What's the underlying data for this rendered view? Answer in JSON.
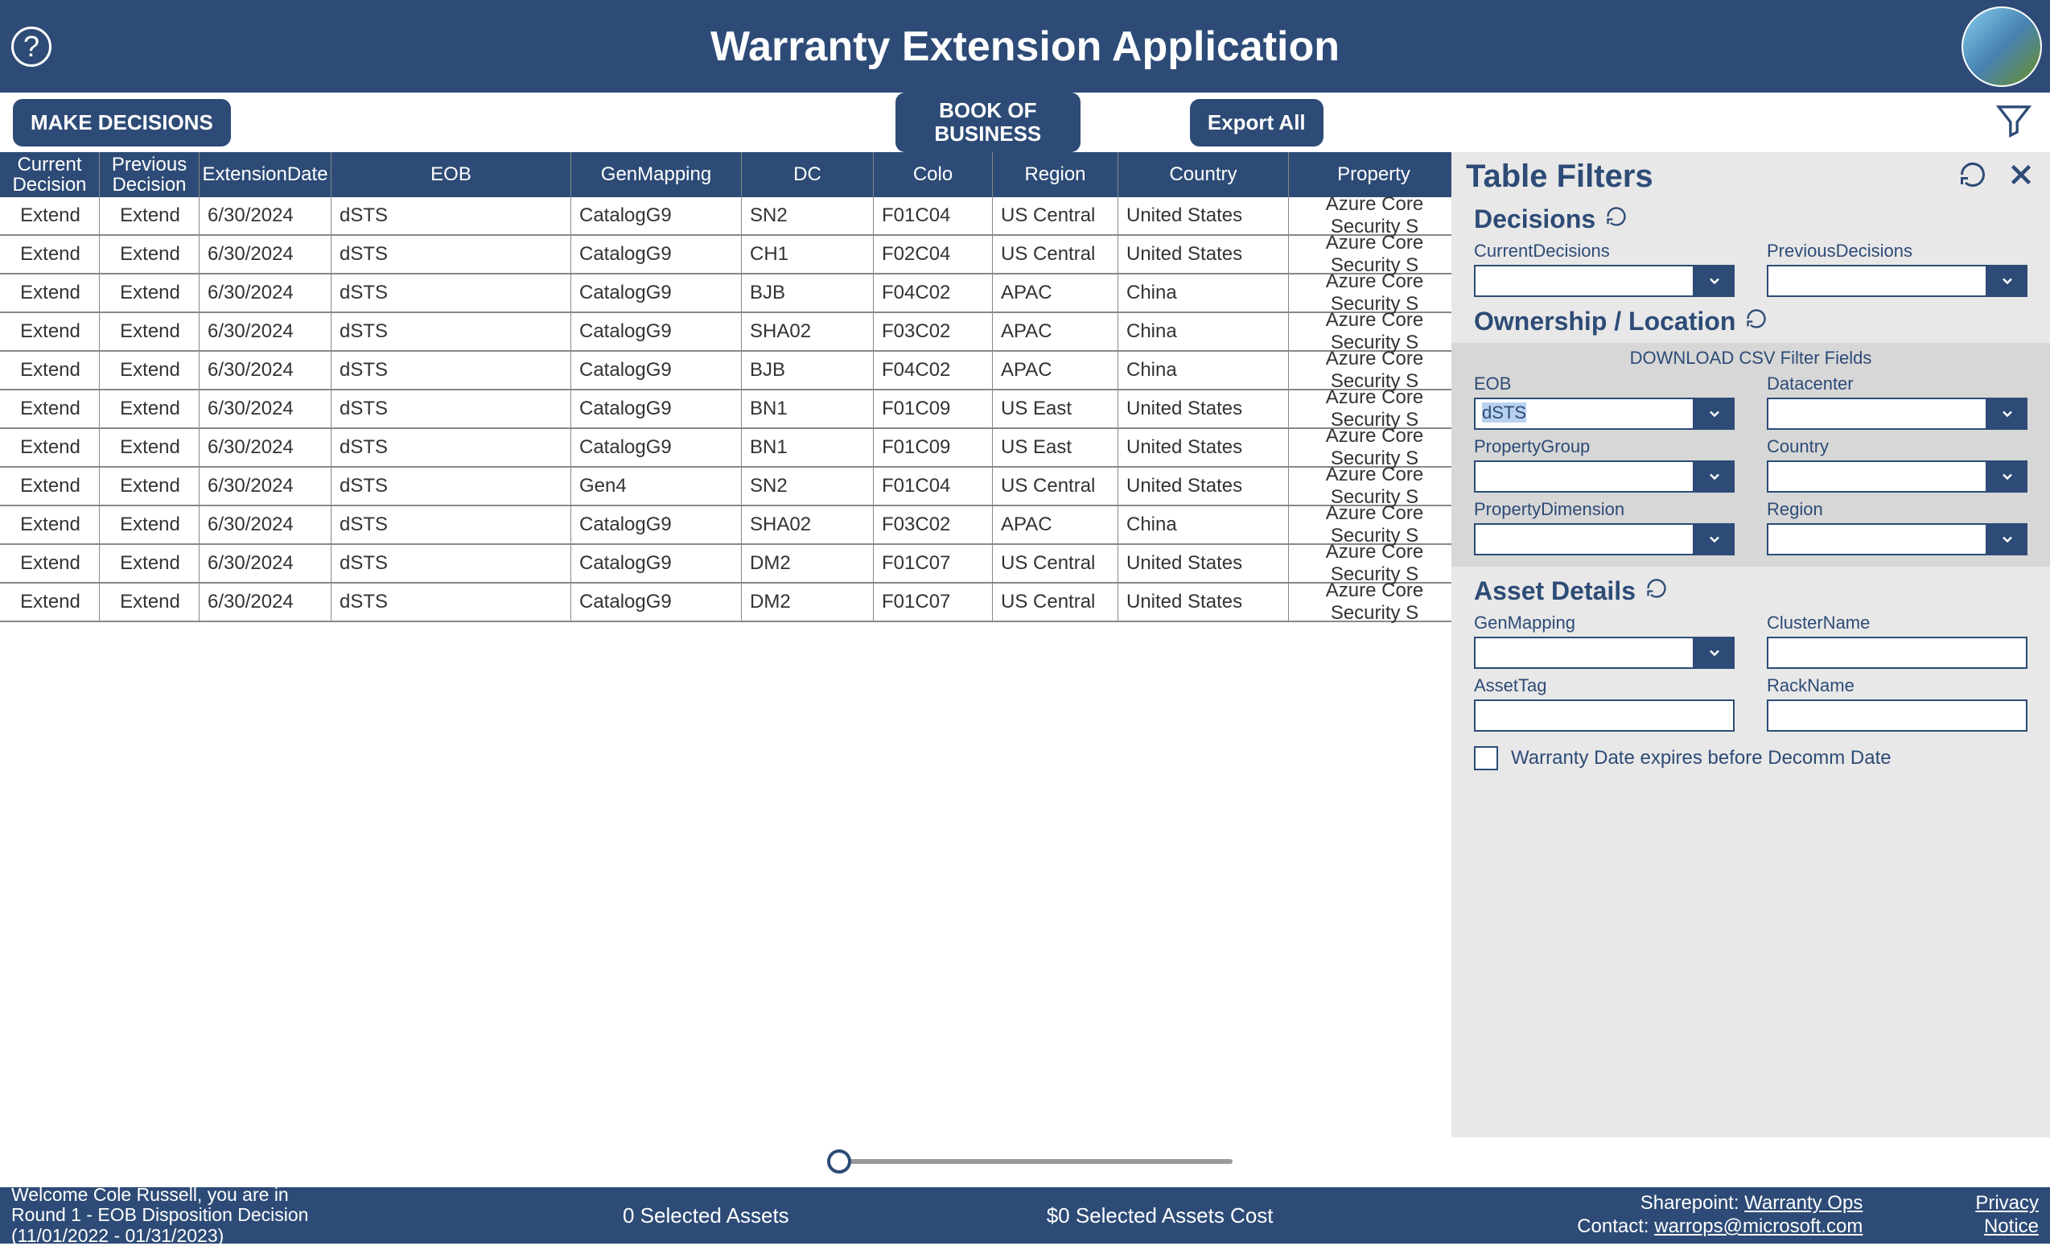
{
  "header": {
    "title": "Warranty Extension Application"
  },
  "toolbar": {
    "make_decisions": "MAKE DECISIONS",
    "book_of_business": "BOOK OF BUSINESS",
    "export_all": "Export All"
  },
  "columns": [
    "Current Decision",
    "Previous Decision",
    "ExtensionDate",
    "EOB",
    "GenMapping",
    "DC",
    "Colo",
    "Region",
    "Country",
    "PropertyGroup"
  ],
  "col_labels": {
    "c0a": "Current",
    "c0b": "Decision",
    "c1a": "Previous",
    "c1b": "Decision",
    "c2": "ExtensionDate",
    "c3": "EOB",
    "c4": "GenMapping",
    "c5": "DC",
    "c6": "Colo",
    "c7": "Region",
    "c8": "Country",
    "c9": "Property"
  },
  "rows": [
    {
      "cur": "Extend",
      "prev": "Extend",
      "ext": "6/30/2024",
      "eob": "dSTS",
      "gen": "CatalogG9",
      "dc": "SN2",
      "colo": "F01C04",
      "region": "US Central",
      "country": "United States",
      "prop": "Azure Core Security S"
    },
    {
      "cur": "Extend",
      "prev": "Extend",
      "ext": "6/30/2024",
      "eob": "dSTS",
      "gen": "CatalogG9",
      "dc": "CH1",
      "colo": "F02C04",
      "region": "US Central",
      "country": "United States",
      "prop": "Azure Core Security S"
    },
    {
      "cur": "Extend",
      "prev": "Extend",
      "ext": "6/30/2024",
      "eob": "dSTS",
      "gen": "CatalogG9",
      "dc": "BJB",
      "colo": "F04C02",
      "region": "APAC",
      "country": "China",
      "prop": "Azure Core Security S"
    },
    {
      "cur": "Extend",
      "prev": "Extend",
      "ext": "6/30/2024",
      "eob": "dSTS",
      "gen": "CatalogG9",
      "dc": "SHA02",
      "colo": "F03C02",
      "region": "APAC",
      "country": "China",
      "prop": "Azure Core Security S"
    },
    {
      "cur": "Extend",
      "prev": "Extend",
      "ext": "6/30/2024",
      "eob": "dSTS",
      "gen": "CatalogG9",
      "dc": "BJB",
      "colo": "F04C02",
      "region": "APAC",
      "country": "China",
      "prop": "Azure Core Security S"
    },
    {
      "cur": "Extend",
      "prev": "Extend",
      "ext": "6/30/2024",
      "eob": "dSTS",
      "gen": "CatalogG9",
      "dc": "BN1",
      "colo": "F01C09",
      "region": "US East",
      "country": "United States",
      "prop": "Azure Core Security S"
    },
    {
      "cur": "Extend",
      "prev": "Extend",
      "ext": "6/30/2024",
      "eob": "dSTS",
      "gen": "CatalogG9",
      "dc": "BN1",
      "colo": "F01C09",
      "region": "US East",
      "country": "United States",
      "prop": "Azure Core Security S"
    },
    {
      "cur": "Extend",
      "prev": "Extend",
      "ext": "6/30/2024",
      "eob": "dSTS",
      "gen": "Gen4",
      "dc": "SN2",
      "colo": "F01C04",
      "region": "US Central",
      "country": "United States",
      "prop": "Azure Core Security S"
    },
    {
      "cur": "Extend",
      "prev": "Extend",
      "ext": "6/30/2024",
      "eob": "dSTS",
      "gen": "CatalogG9",
      "dc": "SHA02",
      "colo": "F03C02",
      "region": "APAC",
      "country": "China",
      "prop": "Azure Core Security S"
    },
    {
      "cur": "Extend",
      "prev": "Extend",
      "ext": "6/30/2024",
      "eob": "dSTS",
      "gen": "CatalogG9",
      "dc": "DM2",
      "colo": "F01C07",
      "region": "US Central",
      "country": "United States",
      "prop": "Azure Core Security S"
    },
    {
      "cur": "Extend",
      "prev": "Extend",
      "ext": "6/30/2024",
      "eob": "dSTS",
      "gen": "CatalogG9",
      "dc": "DM2",
      "colo": "F01C07",
      "region": "US Central",
      "country": "United States",
      "prop": "Azure Core Security S"
    }
  ],
  "filters": {
    "title": "Table Filters",
    "decisions_title": "Decisions",
    "current_decisions": "CurrentDecisions",
    "previous_decisions": "PreviousDecisions",
    "ownership_title": "Ownership / Location",
    "download_csv": "DOWNLOAD CSV Filter Fields",
    "eob_label": "EOB",
    "eob_value": "dSTS",
    "datacenter_label": "Datacenter",
    "propertygroup_label": "PropertyGroup",
    "country_label": "Country",
    "propertydimension_label": "PropertyDimension",
    "region_label": "Region",
    "asset_details_title": "Asset Details",
    "genmapping_label": "GenMapping",
    "clustername_label": "ClusterName",
    "assettag_label": "AssetTag",
    "rackname_label": "RackName",
    "warranty_expires": "Warranty Date expires before Decomm Date"
  },
  "footer": {
    "welcome_l1": "Welcome Cole Russell, you are in",
    "welcome_l2": "Round 1 - EOB Disposition Decision",
    "welcome_l3": "(11/01/2022 - 01/31/2023)",
    "selected_assets": "0 Selected Assets",
    "selected_cost": "$0 Selected Assets Cost",
    "sharepoint_label": "Sharepoint: ",
    "sharepoint_link": "Warranty Ops",
    "contact_label": "Contact: ",
    "contact_link": "warrops@microsoft.com",
    "privacy": "Privacy",
    "notice": "Notice"
  }
}
